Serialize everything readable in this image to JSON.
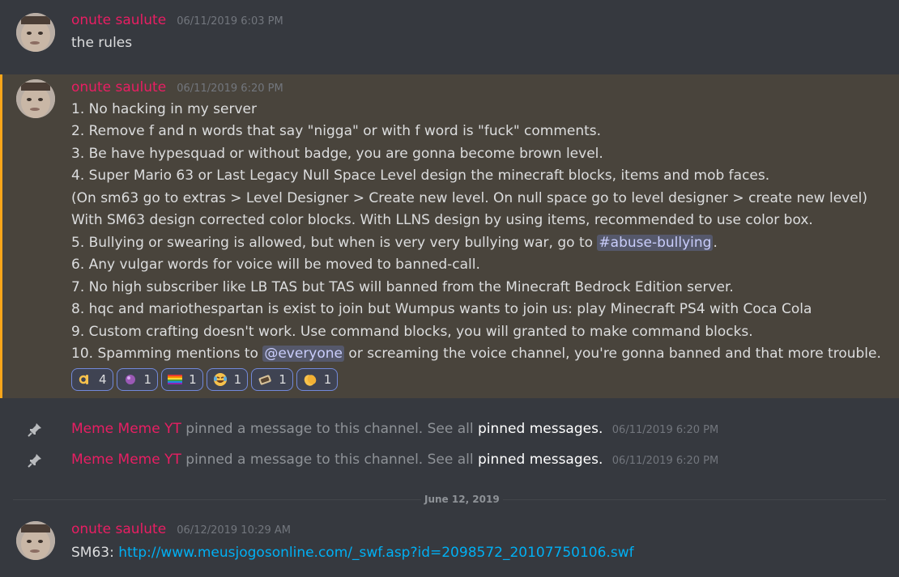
{
  "messages": [
    {
      "username": "onute saulute",
      "timestamp": "06/11/2019 6:03 PM",
      "lines": [
        "the rules"
      ]
    },
    {
      "username": "onute saulute",
      "timestamp": "06/11/2019 6:20 PM",
      "lines": [
        "1. No hacking in my server",
        "2. Remove f and n words that say \"nigga\" or with f word is \"fuck\" comments.",
        "3. Be have hypesquad or without badge, you are gonna become brown level.",
        "4. Super Mario 63 or Last Legacy Null Space Level design the minecraft blocks, items and mob faces.",
        "(On sm63 go to extras > Level Designer > Create new level. On null space go to level designer > create new level)",
        "With SM63 design corrected color blocks. With LLNS design by using items, recommended to use color box.",
        "6. Any vulgar words for voice will be moved to banned-call.",
        "7. No high subscriber like LB TAS but TAS will banned from the Minecraft Bedrock Edition server.",
        "8. hqc and mariothespartan is exist to join but Wumpus wants to join us: play Minecraft PS4 with Coca Cola",
        "9. Custom crafting doesn't work. Use command blocks, you will granted to make command blocks."
      ],
      "line5_prefix": "5. Bullying or swearing is allowed, but when is very very bullying war, go to",
      "line5_channel": "#abuse-bullying",
      "line5_suffix": ".",
      "line10_prefix": "10. Spamming mentions to",
      "line10_mention": "@everyone",
      "line10_suffix": "or screaming the voice channel, you're gonna banned and that more trouble.",
      "reactions": [
        {
          "icon": "ok-hand-icon",
          "count": "4"
        },
        {
          "icon": "purple-gem-icon",
          "count": "1"
        },
        {
          "icon": "rainbow-flag-icon",
          "count": "1"
        },
        {
          "icon": "tears-of-joy-icon",
          "count": "1"
        },
        {
          "icon": "bread-icon",
          "count": "1"
        },
        {
          "icon": "clapping-hands-icon",
          "count": "1"
        }
      ]
    }
  ],
  "system_messages": [
    {
      "user": "Meme Meme YT",
      "text": "pinned a message to this channel. See all",
      "link": "pinned messages.",
      "timestamp": "06/11/2019 6:20 PM"
    },
    {
      "user": "Meme Meme YT",
      "text": "pinned a message to this channel. See all",
      "link": "pinned messages.",
      "timestamp": "06/11/2019 6:20 PM"
    }
  ],
  "date_divider": "June 12, 2019",
  "last_message": {
    "username": "onute saulute",
    "timestamp": "06/12/2019 10:29 AM",
    "prefix": "SM63:",
    "url": "http://www.meusjogosonline.com/_swf.asp?id=2098572_20107750106.swf"
  },
  "colors": {
    "background": "#36393f",
    "username": "#e91e63",
    "highlight": "#49443c",
    "highlight_border": "#faa61a",
    "mention": "#c9cdfb",
    "link": "#00b0f4"
  }
}
